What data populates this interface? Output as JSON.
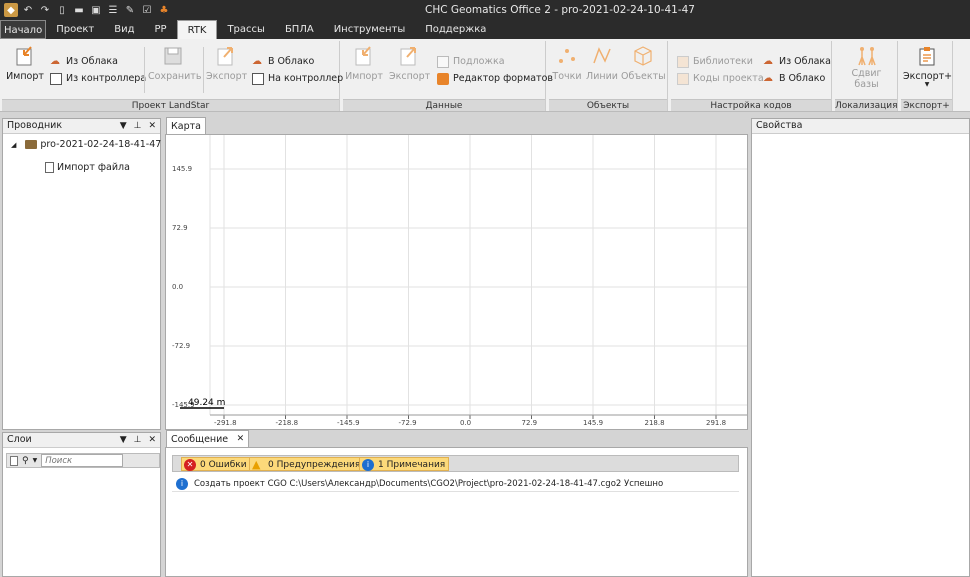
{
  "window": {
    "title": "CHC Geomatics Office 2 - pro-2021-02-24-10-41-47"
  },
  "menu_tabs": [
    "Начало",
    "Проект",
    "Вид",
    "PP",
    "RTK",
    "Трассы",
    "БПЛА",
    "Инструменты",
    "Поддержка"
  ],
  "active_tab": "RTK",
  "ribbon": {
    "landstar": {
      "label": "Проект LandStar",
      "import": "Импорт",
      "from_cloud": "Из Облака",
      "from_controller": "Из контроллера",
      "save": "Сохранить",
      "export": "Экспорт",
      "to_cloud": "В Облако",
      "to_controller": "На контроллер"
    },
    "data": {
      "label": "Данные",
      "import": "Импорт",
      "export": "Экспорт",
      "background": "Подложка",
      "format_editor": "Редактор форматов"
    },
    "objects": {
      "label": "Объекты",
      "points": "Точки",
      "lines": "Линии",
      "objects": "Объекты"
    },
    "codes": {
      "label": "Настройка кодов",
      "libraries": "Библиотеки",
      "project_codes": "Коды проекта",
      "from_cloud": "Из Облака",
      "to_cloud": "В Облако"
    },
    "localization": {
      "label": "Локализация",
      "base_shift_1": "Сдвиг",
      "base_shift_2": "базы"
    },
    "exportplus": {
      "label": "Экспорт+",
      "button": "Экспорт+"
    }
  },
  "explorer": {
    "title": "Проводник",
    "project": "pro-2021-02-24-18-41-47",
    "child": "Импорт файла"
  },
  "layers": {
    "title": "Слои",
    "search_placeholder": "Поиск"
  },
  "map": {
    "tab": "Карта",
    "y_ticks": [
      "145.9",
      "72.9",
      "0.0",
      "-72.9",
      "-145.9"
    ],
    "x_ticks": [
      "-291.8",
      "-218.8",
      "-145.9",
      "-72.9",
      "0.0",
      "72.9",
      "145.9",
      "218.8",
      "291.8"
    ],
    "scale": "49.24 m"
  },
  "properties": {
    "title": "Свойства"
  },
  "messages": {
    "tab": "Сообщение",
    "errors": "0 Ошибки",
    "warnings": "0 Предупреждения",
    "notes": "1 Примечания",
    "rows": [
      {
        "text": "Создать проект CGO C:\\Users\\Александр\\Documents\\CGO2\\Project\\pro-2021-02-24-18-41-47.cgo2 Успешно"
      }
    ]
  },
  "colors": {
    "accent": "#e8842a",
    "disabled": "#9a9a9a",
    "titlebar": "#2b2b2b"
  }
}
